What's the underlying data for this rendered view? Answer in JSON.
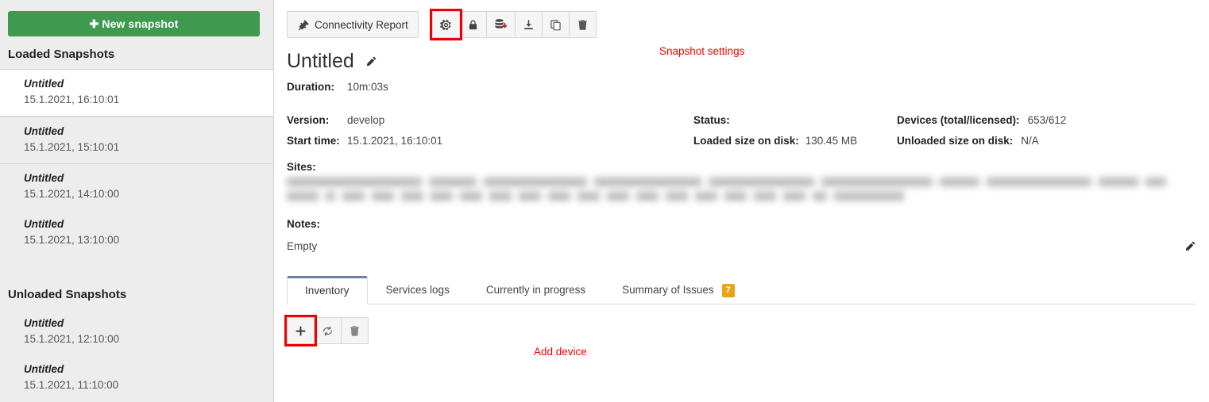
{
  "sidebar": {
    "new_snapshot_label": "New snapshot",
    "new_snapshot_icon": "plus-icon",
    "groups": [
      {
        "heading": "Loaded Snapshots",
        "items": [
          {
            "title": "Untitled",
            "date": "15.1.2021, 16:10:01",
            "selected": true
          },
          {
            "title": "Untitled",
            "date": "15.1.2021, 15:10:01",
            "selected": false
          },
          {
            "title": "Untitled",
            "date": "15.1.2021, 14:10:00",
            "selected": false
          },
          {
            "title": "Untitled",
            "date": "15.1.2021, 13:10:00",
            "selected": false
          }
        ]
      },
      {
        "heading": "Unloaded Snapshots",
        "items": [
          {
            "title": "Untitled",
            "date": "15.1.2021, 12:10:00",
            "selected": false
          },
          {
            "title": "Untitled",
            "date": "15.1.2021, 11:10:00",
            "selected": false
          }
        ]
      }
    ]
  },
  "toolbar": {
    "connectivity_report_label": "Connectivity Report",
    "connectivity_report_icon": "plug-icon",
    "settings_icon": "gear-icon",
    "lock_icon": "lock-icon",
    "unload_icon": "database-download-icon",
    "download_icon": "download-icon",
    "clone_icon": "copy-icon",
    "delete_icon": "trash-icon"
  },
  "annotations": {
    "settings": "Snapshot settings",
    "add_device": "Add device",
    "color": "#ee0000"
  },
  "header": {
    "title": "Untitled",
    "edit_icon": "pencil-icon",
    "duration_label": "Duration:",
    "duration_value": "10m:03s"
  },
  "info": {
    "rows": [
      [
        {
          "label": "Version:",
          "value": "develop"
        },
        {
          "label": "Status:",
          "value": ""
        },
        {
          "label": "Devices (total/licensed):",
          "value": "653/612"
        }
      ],
      [
        {
          "label": "Start time:",
          "value": "15.1.2021, 16:10:01"
        },
        {
          "label": "Loaded size on disk:",
          "value": "130.45 MB"
        },
        {
          "label": "Unloaded size on disk:",
          "value": "N/A"
        }
      ]
    ]
  },
  "sites": {
    "label": "Sites:",
    "redacted": true,
    "row1_widths": [
      170,
      60,
      130,
      135,
      133,
      140,
      50,
      132,
      50,
      26
    ],
    "row2_widths": [
      40,
      12,
      28,
      28,
      28,
      28,
      28,
      28,
      28,
      28,
      28,
      28,
      28,
      28,
      28,
      28,
      28,
      28,
      18,
      88
    ]
  },
  "notes": {
    "label": "Notes:",
    "value": "Empty",
    "edit_icon": "pencil-icon"
  },
  "tabs": [
    {
      "label": "Inventory",
      "active": true,
      "badge": null
    },
    {
      "label": "Services logs",
      "active": false,
      "badge": null
    },
    {
      "label": "Currently in progress",
      "active": false,
      "badge": null
    },
    {
      "label": "Summary of Issues",
      "active": false,
      "badge": "7"
    }
  ],
  "bottom_toolbar": {
    "add_icon": "plus-icon",
    "refresh_icon": "refresh-icon",
    "delete_icon": "trash-icon"
  },
  "colors": {
    "primary_green": "#3d9a4e",
    "badge_orange": "#e8a317",
    "annotation_red": "#ee0000",
    "active_tab_border": "#6a7f9c"
  }
}
